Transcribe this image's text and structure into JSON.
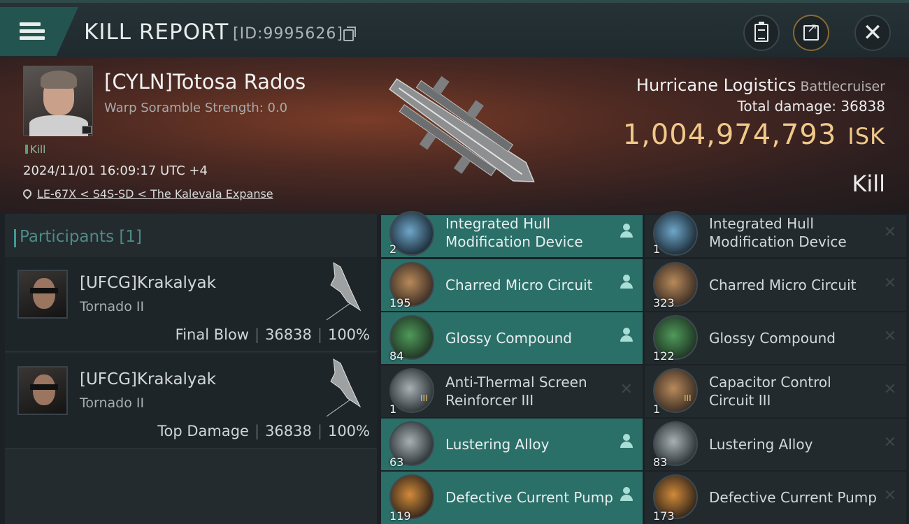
{
  "header": {
    "title": "KILL REPORT",
    "report_id": "[ID:9995626]"
  },
  "victim": {
    "name": "[CYLN]Totosa Rados",
    "scramble": "Warp Soramble Strength: 0.0",
    "kill_tag": "Kill",
    "datetime": "2024/11/01 16:09:17 UTC +4",
    "location": "LE-67X < S4S-SD < The Kalevala Expanse",
    "ship_name": "Hurricane Logistics",
    "ship_class": "Battlecruiser",
    "total_damage_label": "Total damage:",
    "total_damage": "36838",
    "isk_value": "1,004,974,793",
    "isk_unit": "ISK",
    "result": "Kill"
  },
  "participants": {
    "label": "Participants",
    "count": "[1]",
    "rows": [
      {
        "name": "[UFCG]Krakalyak",
        "ship": "Tornado II",
        "role": "Final Blow",
        "damage": "36838",
        "percent": "100%"
      },
      {
        "name": "[UFCG]Krakalyak",
        "ship": "Tornado II",
        "role": "Top Damage",
        "damage": "36838",
        "percent": "100%"
      }
    ]
  },
  "items": {
    "dropped": [
      {
        "name": "Integrated Hull Modification Device",
        "qty": "2",
        "icon": "hull-device-icon"
      },
      {
        "name": "Charred Micro Circuit",
        "qty": "195",
        "icon": "micro-circuit-icon"
      },
      {
        "name": "Glossy Compound",
        "qty": "84",
        "icon": "glossy-compound-icon"
      },
      {
        "name": "Anti-Thermal Screen Reinforcer III",
        "qty": "1",
        "tier": "III",
        "icon": "shield-module-icon"
      },
      {
        "name": "Lustering Alloy",
        "qty": "63",
        "icon": "alloy-icon"
      },
      {
        "name": "Defective Current Pump",
        "qty": "119",
        "icon": "current-pump-icon"
      }
    ],
    "destroyed": [
      {
        "name": "Integrated Hull Modification Device",
        "qty": "1",
        "icon": "hull-device-icon"
      },
      {
        "name": "Charred Micro Circuit",
        "qty": "323",
        "icon": "micro-circuit-icon"
      },
      {
        "name": "Glossy Compound",
        "qty": "122",
        "icon": "glossy-compound-icon"
      },
      {
        "name": "Capacitor Control Circuit III",
        "qty": "1",
        "tier": "III",
        "icon": "capacitor-circuit-icon"
      },
      {
        "name": "Lustering Alloy",
        "qty": "83",
        "icon": "alloy-icon"
      },
      {
        "name": "Defective Current Pump",
        "qty": "173",
        "icon": "current-pump-icon"
      }
    ]
  },
  "colors": {
    "accent": "#2b6f69",
    "isk_gold": "#f0c88a",
    "panel": "#222a2e"
  }
}
